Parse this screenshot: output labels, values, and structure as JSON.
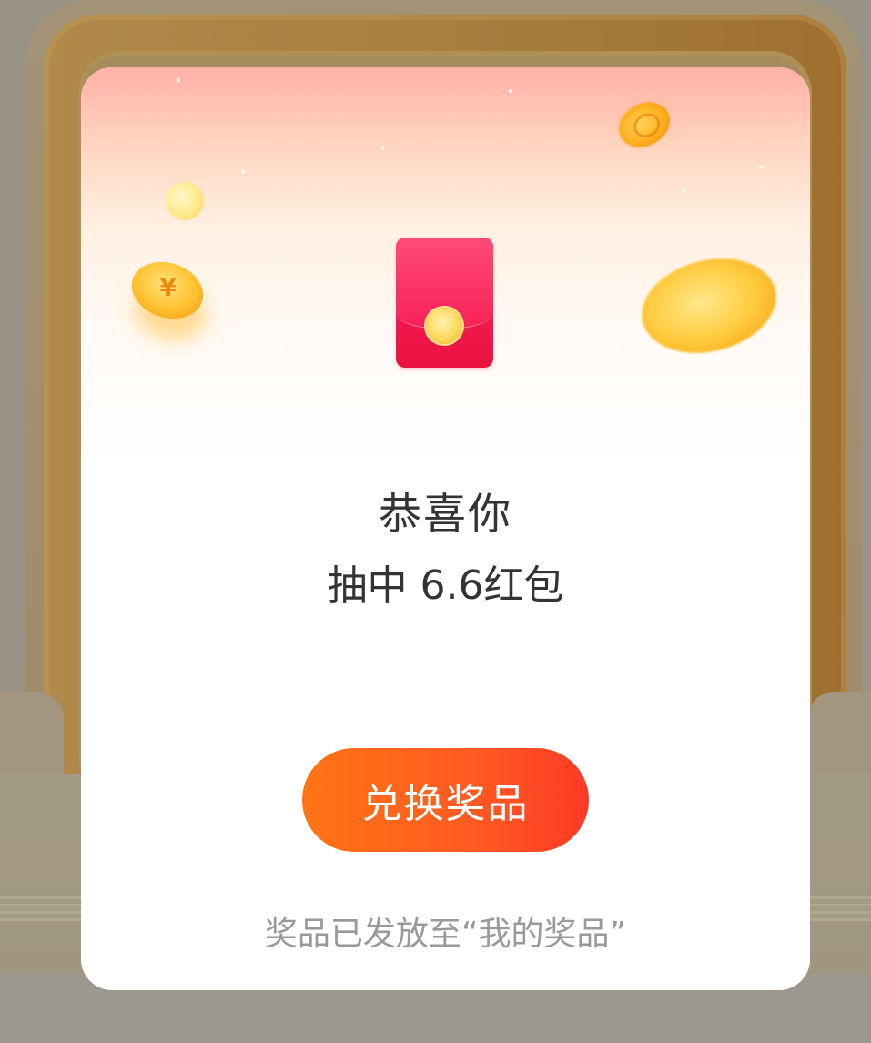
{
  "modal": {
    "title": "恭喜你",
    "subtitle": "抽中 6.6红包",
    "redeem_button_label": "兑换奖品",
    "footnote": "奖品已发放至“我的奖品”"
  },
  "decor": {
    "coin_symbol": "¥",
    "icons": [
      "red-envelope-icon",
      "coin-icon"
    ]
  },
  "colors": {
    "button_gradient_start": "#ff7414",
    "button_gradient_end": "#ff3a25",
    "envelope_red": "#f21a4e",
    "text_primary": "#333333",
    "text_secondary": "#999999"
  }
}
